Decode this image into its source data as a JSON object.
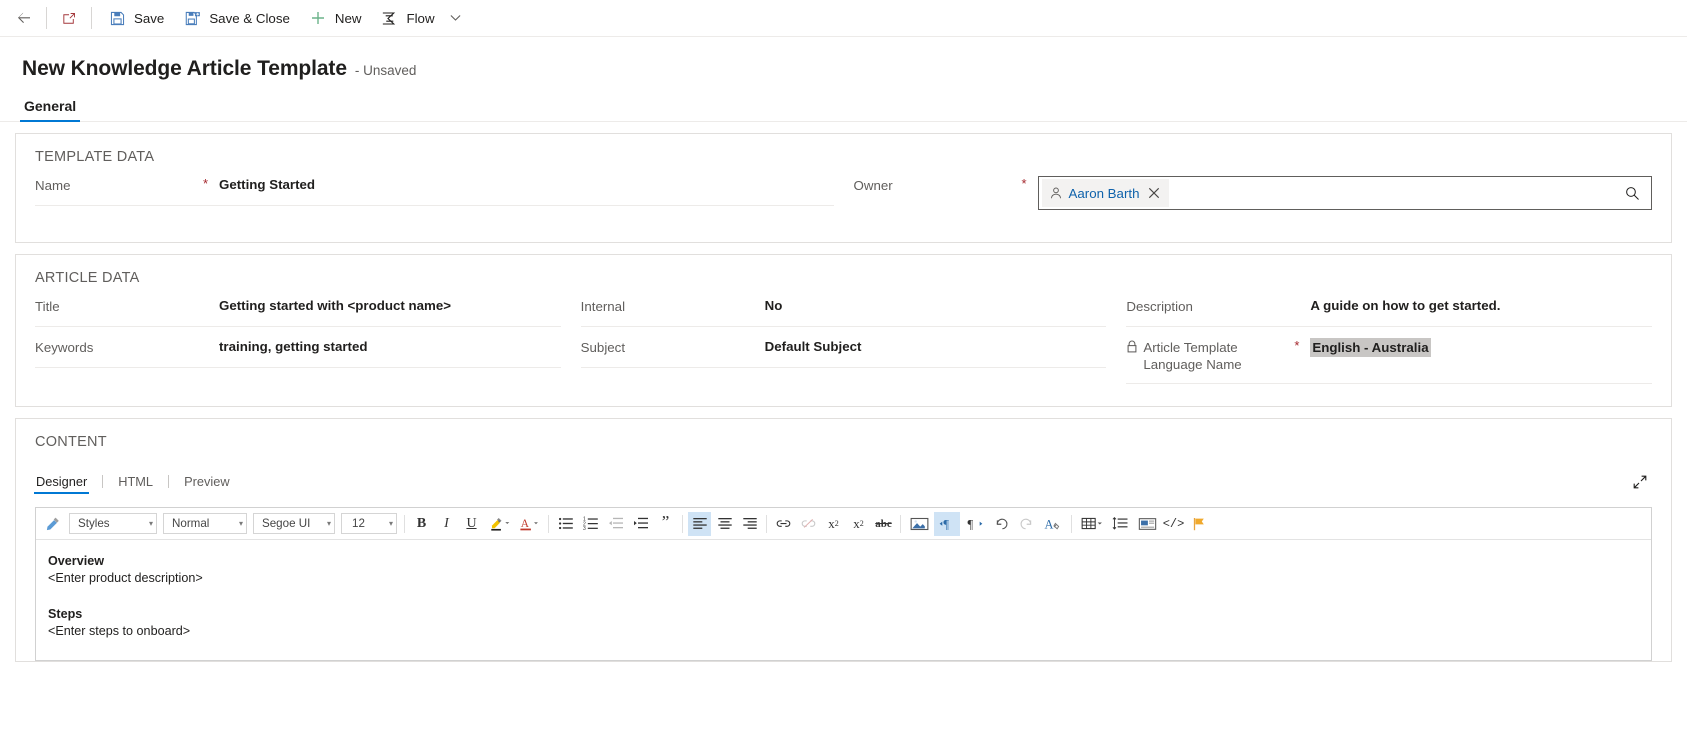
{
  "commandbar": {
    "back_icon": "arrow-left-icon",
    "popout_icon": "open-in-new-window-icon",
    "items": [
      {
        "label": "Save",
        "icon": "save-icon"
      },
      {
        "label": "Save & Close",
        "icon": "save-and-close-icon"
      },
      {
        "label": "New",
        "icon": "plus-icon"
      },
      {
        "label": "Flow",
        "icon": "flow-icon"
      }
    ],
    "overflow_icon": "chevron-down-icon"
  },
  "header": {
    "title": "New Knowledge Article Template",
    "status": "- Unsaved"
  },
  "tabs": [
    {
      "label": "General",
      "active": true
    }
  ],
  "template_data": {
    "section_title": "TEMPLATE DATA",
    "name": {
      "label": "Name",
      "required": "*",
      "value": "Getting Started"
    },
    "owner": {
      "label": "Owner",
      "required": "*",
      "chip_name": "Aaron Barth",
      "chip_icon": "person-icon",
      "remove_icon": "close-icon",
      "search_icon": "search-icon",
      "chip_text_color": "#0f62ab"
    }
  },
  "article_data": {
    "section_title": "ARTICLE DATA",
    "left": [
      {
        "label": "Title",
        "value": "Getting started with <product name>"
      },
      {
        "label": "Keywords",
        "value": "training, getting started"
      }
    ],
    "middle": [
      {
        "label": "Internal",
        "value": "No"
      },
      {
        "label": "Subject",
        "value": "Default Subject"
      }
    ],
    "right": [
      {
        "label": "Description",
        "value": "A guide on how to get started."
      }
    ],
    "language": {
      "label_line1": "Article Template",
      "label_line2": "Language Name",
      "required": "*",
      "lock_icon": "lock-icon",
      "value": "English - Australia",
      "highlight_color": "#c8c6c4"
    }
  },
  "content": {
    "section_title": "CONTENT",
    "editor_tabs": [
      {
        "label": "Designer",
        "active": true
      },
      {
        "label": "HTML",
        "active": false
      },
      {
        "label": "Preview",
        "active": false
      }
    ],
    "expand_icon": "expand-diagonal-icon",
    "toolbar": {
      "format_painter_icon": "format-painter-icon",
      "styles": {
        "value": "Styles",
        "caret": "▾"
      },
      "paragraph_format": {
        "value": "Normal",
        "caret": "▾"
      },
      "font_family": {
        "value": "Segoe UI",
        "caret": "▾"
      },
      "font_size": {
        "value": "12",
        "caret": "▾"
      },
      "bold": {
        "label": "B",
        "icon": "bold-icon"
      },
      "italic": {
        "label": "I",
        "icon": "italic-icon"
      },
      "underline": {
        "label": "U",
        "icon": "underline-icon"
      },
      "highlight_icon": "text-highlight-icon",
      "font_color_icon": "font-color-icon",
      "bullet_list_icon": "bulleted-list-icon",
      "numbered_list_icon": "numbered-list-icon",
      "outdent_icon": "decrease-indent-icon",
      "indent_icon": "increase-indent-icon",
      "blockquote_icon": "blockquote-icon",
      "align_left_icon": "align-left-icon",
      "align_center_icon": "align-center-icon",
      "align_right_icon": "align-right-icon",
      "link_icon": "insert-link-icon",
      "unlink_icon": "remove-link-icon",
      "superscript_icon": "superscript-icon",
      "subscript_icon": "subscript-icon",
      "strikethrough_icon": "strikethrough-icon",
      "image_icon": "insert-image-icon",
      "ltr_icon": "left-to-right-icon",
      "rtl_icon": "right-to-left-icon",
      "undo_icon": "undo-icon",
      "redo_icon": "redo-icon",
      "clear_format_icon": "clear-formatting-icon",
      "table_icon": "insert-table-icon",
      "line_spacing_icon": "line-spacing-icon",
      "insert_snippet_icon": "insert-snippet-icon",
      "source_code_icon": "source-code-icon",
      "flag_icon": "flag-icon",
      "active_button": "left-to-right-icon",
      "disabled_buttons": [
        "remove-link-icon",
        "redo-icon"
      ],
      "active_highlight_color": "#cfe3f5"
    },
    "document": [
      {
        "type": "heading",
        "text": "Overview"
      },
      {
        "type": "paragraph",
        "text": "<Enter product description>"
      },
      {
        "type": "spacer"
      },
      {
        "type": "heading",
        "text": "Steps"
      },
      {
        "type": "paragraph",
        "text": "<Enter steps to onboard>"
      }
    ]
  }
}
